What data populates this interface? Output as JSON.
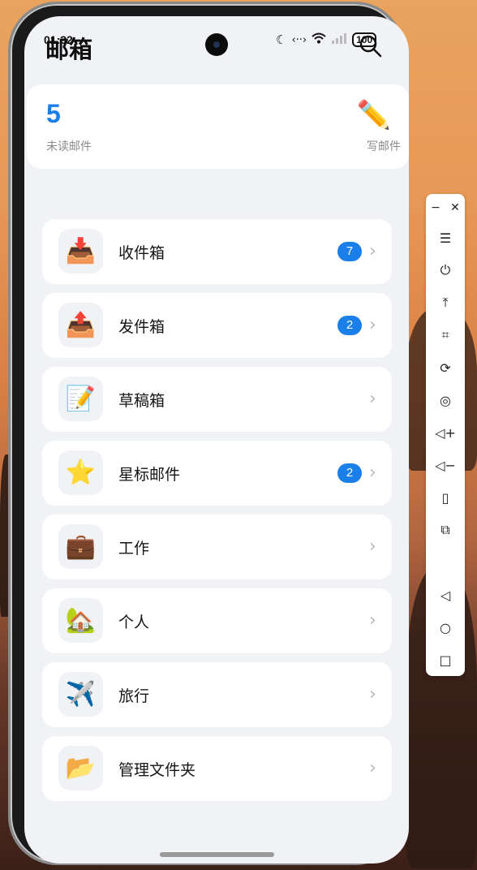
{
  "status_bar": {
    "time": "01:32",
    "battery": "100"
  },
  "header": {
    "title": "邮箱"
  },
  "summary": {
    "unread_count": "5",
    "unread_label": "未读邮件",
    "compose_label": "写邮件",
    "compose_icon": "pencil-icon"
  },
  "folders": [
    {
      "label": "收件箱",
      "icon": "inbox-tray-icon",
      "badge": "7"
    },
    {
      "label": "发件箱",
      "icon": "outbox-tray-icon",
      "badge": "2"
    },
    {
      "label": "草稿箱",
      "icon": "memo-icon",
      "badge": ""
    },
    {
      "label": "星标邮件",
      "icon": "star-icon",
      "badge": "2"
    },
    {
      "label": "工作",
      "icon": "briefcase-icon",
      "badge": ""
    },
    {
      "label": "个人",
      "icon": "house-icon",
      "badge": ""
    },
    {
      "label": "旅行",
      "icon": "airplane-icon",
      "badge": ""
    },
    {
      "label": "管理文件夹",
      "icon": "folder-icon",
      "badge": ""
    }
  ],
  "colors": {
    "accent": "#1a7fe8",
    "screen_bg": "#f1f2f5",
    "card_bg": "#ffffff"
  },
  "emulator_toolbar": {
    "buttons": [
      "minimize-icon",
      "close-icon",
      "menu-icon",
      "power-icon",
      "pin-top-icon",
      "crop-icon",
      "rotate-icon",
      "screenshot-icon",
      "volume-up-icon",
      "volume-down-icon",
      "shake-icon",
      "multi-device-icon",
      "back-icon",
      "home-icon",
      "recents-icon"
    ]
  }
}
